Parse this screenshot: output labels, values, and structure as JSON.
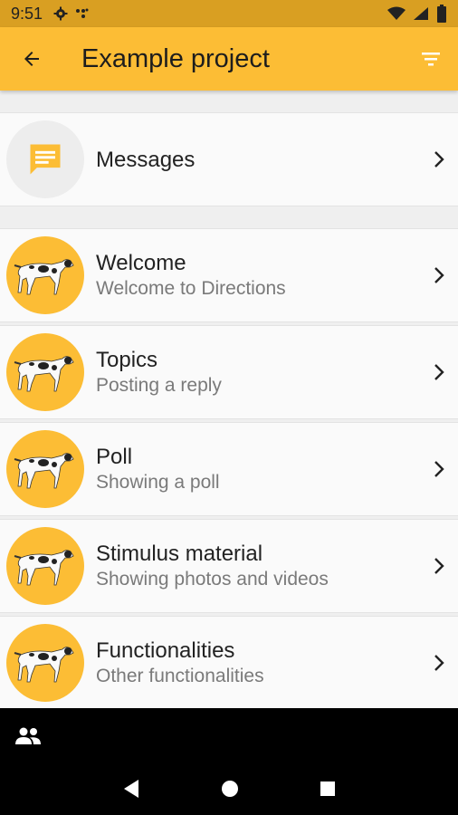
{
  "status_bar": {
    "time": "9:51",
    "left_icons": [
      "gear-icon",
      "signal-dots-icon"
    ],
    "right_icons": [
      "wifi-icon",
      "cell-signal-icon",
      "battery-icon"
    ]
  },
  "app_bar": {
    "title": "Example project",
    "back_icon": "arrow-left-icon",
    "filter_icon": "filter-icon",
    "color": "#fcbd35"
  },
  "messages": {
    "title": "Messages",
    "icon": "chat-bubble-icon"
  },
  "topics": [
    {
      "title": "Welcome",
      "subtitle": "Welcome to Directions"
    },
    {
      "title": "Topics",
      "subtitle": "Posting a reply"
    },
    {
      "title": "Poll",
      "subtitle": "Showing a poll"
    },
    {
      "title": "Stimulus material",
      "subtitle": "Showing photos and videos"
    },
    {
      "title": "Functionalities",
      "subtitle": "Other functionalities"
    }
  ],
  "bottom_tab": {
    "icon": "people-icon"
  },
  "nav_bar": {
    "icons": [
      "back-triangle-icon",
      "home-circle-icon",
      "recents-square-icon"
    ]
  }
}
